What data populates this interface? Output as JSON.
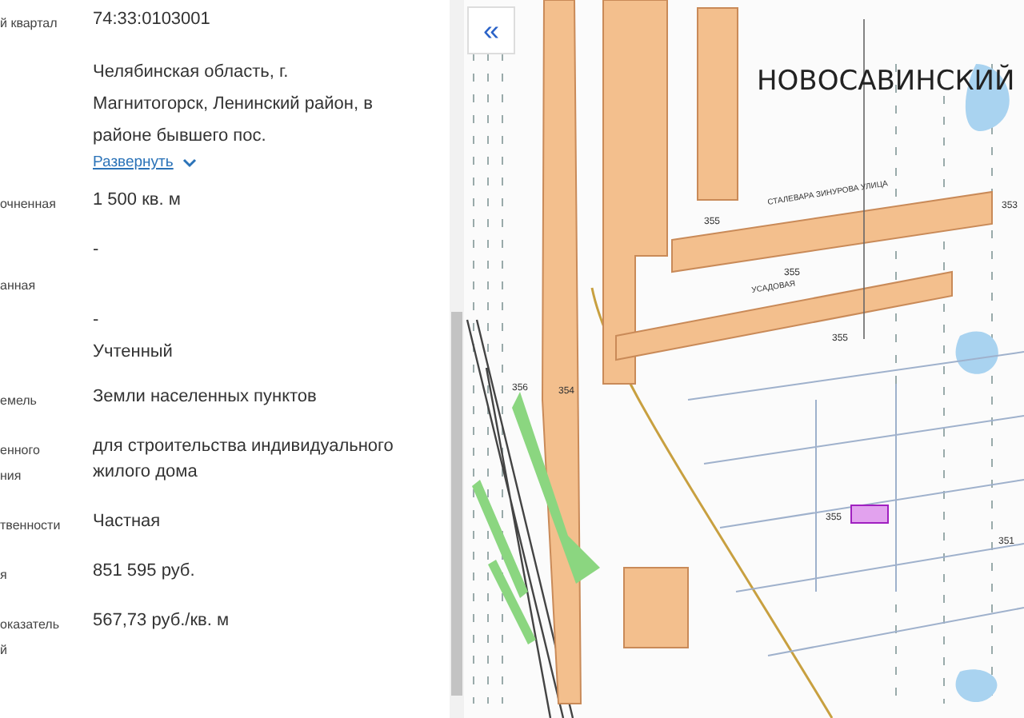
{
  "info_panel": {
    "rows": [
      {
        "label": [
          "й квартал"
        ],
        "value": [
          "74:33:0103001"
        ]
      },
      {
        "label": [],
        "value": [
          "Челябинская область, г.",
          "Магнитогорск, Ленинский район, в",
          "районе бывшего пос."
        ],
        "expand_link": "Развернуть"
      },
      {
        "label": [
          "очненная"
        ],
        "value": [
          "1 500 кв. м"
        ]
      },
      {
        "label": [],
        "value": [
          "-"
        ]
      },
      {
        "label": [
          "анная"
        ],
        "value": []
      },
      {
        "label": [],
        "value": [
          "-"
        ]
      },
      {
        "label": [],
        "value": [
          "Учтенный"
        ]
      },
      {
        "label": [
          "емель"
        ],
        "value": [
          "Земли населенных пунктов"
        ]
      },
      {
        "label": [
          "енного",
          "ния"
        ],
        "value": [
          "для строительства индивидуального",
          "жилого дома"
        ]
      },
      {
        "label": [
          "твенности"
        ],
        "value": [
          "Частная"
        ]
      },
      {
        "label": [
          "я"
        ],
        "value": [
          "851 595 руб."
        ]
      },
      {
        "label": [
          "оказатель",
          "й"
        ],
        "value": [
          "567,73 руб./кв. м"
        ]
      }
    ]
  },
  "map": {
    "collapse_button": "«",
    "district_label": "НОВОСАВИНСКИЙ",
    "street_labels": [
      "УСАДОВАЯ",
      "СТАЛЕВАРА ЗИНУРОВА УЛИЦА"
    ],
    "height_labels": [
      "356",
      "355",
      "355",
      "355",
      "354",
      "355",
      "351",
      "353"
    ]
  }
}
